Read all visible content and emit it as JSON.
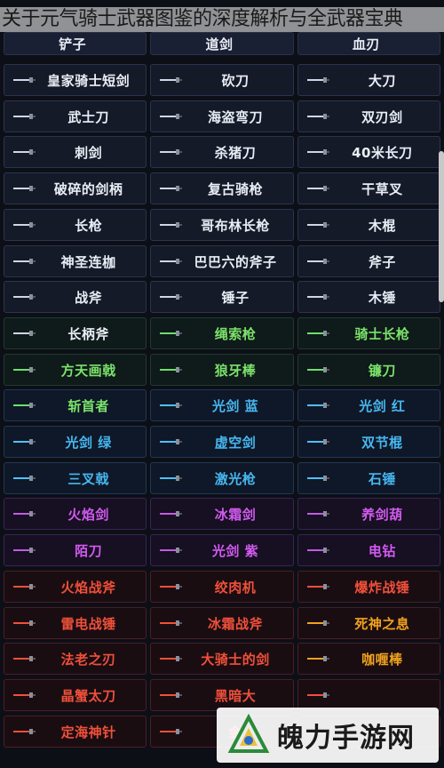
{
  "title": "关于元气骑士武器图鉴的深度解析与全武器宝典",
  "header": [
    "铲子",
    "道剑",
    "血刃"
  ],
  "rows": [
    {
      "section": "white",
      "cells": [
        {
          "label": "皇家骑士短剑",
          "color": "w"
        },
        {
          "label": "砍刀",
          "color": "w"
        },
        {
          "label": "大刀",
          "color": "w"
        }
      ]
    },
    {
      "section": "white",
      "cells": [
        {
          "label": "武士刀",
          "color": "w"
        },
        {
          "label": "海盗弯刀",
          "color": "w"
        },
        {
          "label": "双刃剑",
          "color": "w"
        }
      ]
    },
    {
      "section": "white",
      "cells": [
        {
          "label": "刺剑",
          "color": "w"
        },
        {
          "label": "杀猪刀",
          "color": "w"
        },
        {
          "label": "40米长刀",
          "color": "w"
        }
      ]
    },
    {
      "section": "white",
      "cells": [
        {
          "label": "破碎的剑柄",
          "color": "w"
        },
        {
          "label": "复古骑枪",
          "color": "w"
        },
        {
          "label": "干草叉",
          "color": "w"
        }
      ]
    },
    {
      "section": "white",
      "cells": [
        {
          "label": "长枪",
          "color": "w"
        },
        {
          "label": "哥布林长枪",
          "color": "w"
        },
        {
          "label": "木棍",
          "color": "w"
        }
      ]
    },
    {
      "section": "white",
      "cells": [
        {
          "label": "神圣连枷",
          "color": "w"
        },
        {
          "label": "巴巴六的斧子",
          "color": "w"
        },
        {
          "label": "斧子",
          "color": "w"
        }
      ]
    },
    {
      "section": "white",
      "cells": [
        {
          "label": "战斧",
          "color": "w"
        },
        {
          "label": "锤子",
          "color": "w"
        },
        {
          "label": "木锤",
          "color": "w"
        }
      ]
    },
    {
      "section": "green",
      "cells": [
        {
          "label": "长柄斧",
          "color": "w"
        },
        {
          "label": "绳索枪",
          "color": "g"
        },
        {
          "label": "骑士长枪",
          "color": "g"
        }
      ]
    },
    {
      "section": "green",
      "cells": [
        {
          "label": "方天画戟",
          "color": "g"
        },
        {
          "label": "狼牙棒",
          "color": "g"
        },
        {
          "label": "镰刀",
          "color": "g"
        }
      ]
    },
    {
      "section": "blue",
      "cells": [
        {
          "label": "斩首者",
          "color": "g"
        },
        {
          "label": "光剑 蓝",
          "color": "b"
        },
        {
          "label": "光剑 红",
          "color": "b"
        }
      ]
    },
    {
      "section": "blue",
      "cells": [
        {
          "label": "光剑 绿",
          "color": "b"
        },
        {
          "label": "虚空剑",
          "color": "b"
        },
        {
          "label": "双节棍",
          "color": "b"
        }
      ]
    },
    {
      "section": "blue",
      "cells": [
        {
          "label": "三叉戟",
          "color": "b"
        },
        {
          "label": "激光枪",
          "color": "b"
        },
        {
          "label": "石锤",
          "color": "b"
        }
      ]
    },
    {
      "section": "purple",
      "cells": [
        {
          "label": "火焰剑",
          "color": "p"
        },
        {
          "label": "冰霜剑",
          "color": "p"
        },
        {
          "label": "养剑葫",
          "color": "p"
        }
      ]
    },
    {
      "section": "purple",
      "cells": [
        {
          "label": "陌刀",
          "color": "p"
        },
        {
          "label": "光剑 紫",
          "color": "p"
        },
        {
          "label": "电钻",
          "color": "p"
        }
      ]
    },
    {
      "section": "red",
      "cells": [
        {
          "label": "火焰战斧",
          "color": "r"
        },
        {
          "label": "绞肉机",
          "color": "r"
        },
        {
          "label": "爆炸战锤",
          "color": "r"
        }
      ]
    },
    {
      "section": "red",
      "cells": [
        {
          "label": "雷电战锤",
          "color": "r"
        },
        {
          "label": "冰霜战斧",
          "color": "r"
        },
        {
          "label": "死神之息",
          "color": "o"
        }
      ]
    },
    {
      "section": "red",
      "cells": [
        {
          "label": "法老之刃",
          "color": "r"
        },
        {
          "label": "大骑士的剑",
          "color": "r"
        },
        {
          "label": "咖喱棒",
          "color": "o"
        }
      ]
    },
    {
      "section": "red",
      "cells": [
        {
          "label": "晶蟹太刀",
          "color": "r"
        },
        {
          "label": "黑暗大",
          "color": "r"
        },
        {
          "label": "",
          "color": "r"
        }
      ]
    },
    {
      "section": "red",
      "cells": [
        {
          "label": "定海神针",
          "color": "r"
        },
        {
          "label": "金",
          "color": "r"
        },
        {
          "label": "",
          "color": "r"
        }
      ]
    }
  ],
  "logo": {
    "text": "魄力手游网"
  }
}
